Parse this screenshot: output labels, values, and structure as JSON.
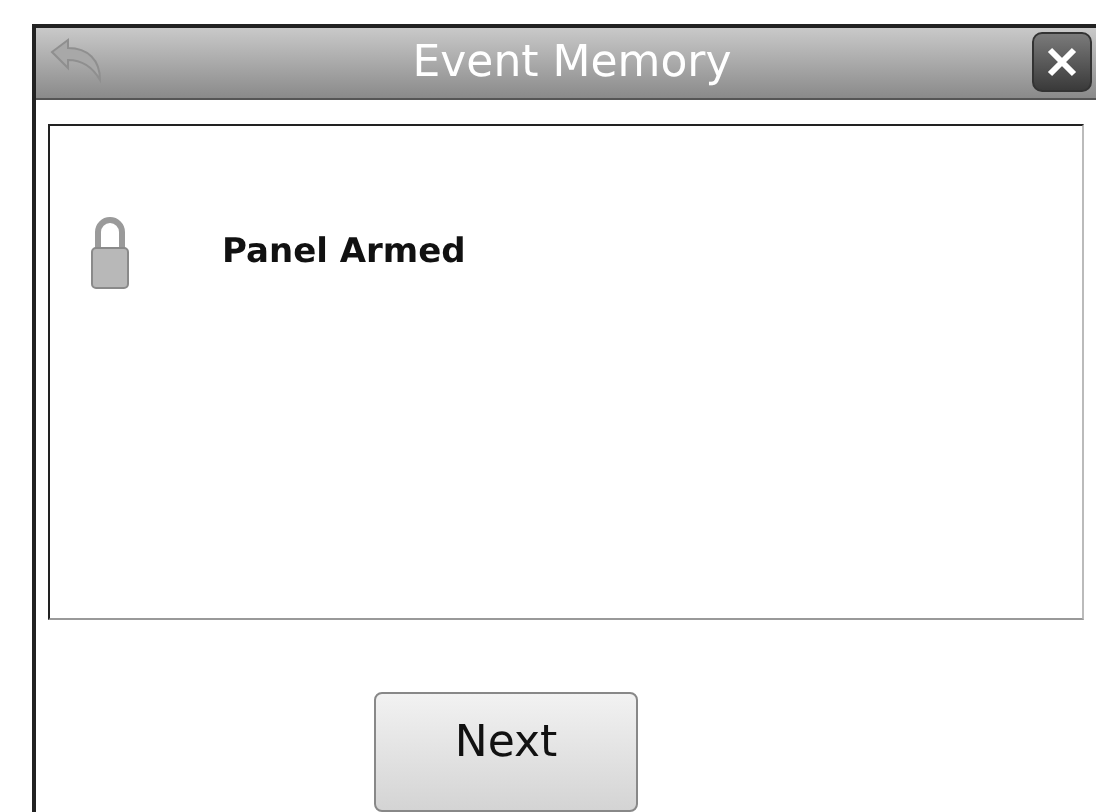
{
  "window": {
    "title": "Event Memory"
  },
  "events": [
    {
      "text": "Panel Armed"
    }
  ],
  "buttons": [
    {
      "label": "Next"
    }
  ]
}
